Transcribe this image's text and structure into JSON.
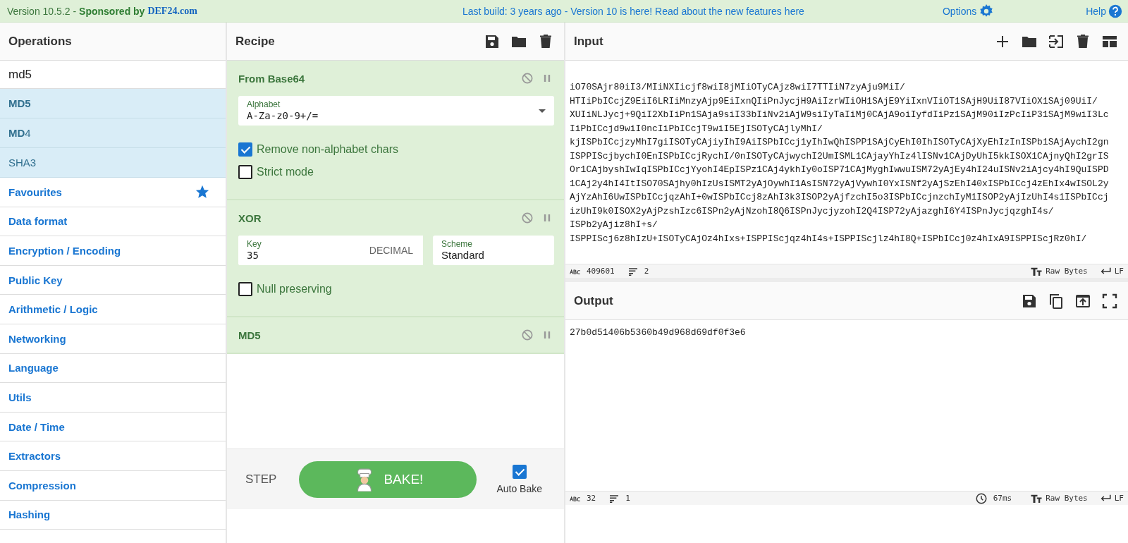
{
  "top_bar": {
    "version": "Version 10.5.2 -",
    "sponsor": "Sponsored by",
    "sponsor_link": "DEF24.com",
    "notice": "Last build: 3 years ago - Version 10 is here! Read about the new features",
    "notice_link": "here",
    "options": "Options",
    "help": "Help"
  },
  "operations": {
    "title": "Operations",
    "search": "md5",
    "results": [
      {
        "label": "**MD5**",
        "selected": false
      },
      {
        "label": "**MD**4",
        "selected": false
      },
      {
        "label": "SHA3",
        "selected": false
      }
    ],
    "categories": [
      {
        "label": "Favourites",
        "kind": "favourites"
      },
      {
        "label": "Data format",
        "kind": "category"
      },
      {
        "label": "Encryption / Encoding",
        "kind": "category"
      },
      {
        "label": "Public Key",
        "kind": "category"
      },
      {
        "label": "Arithmetic / Logic",
        "kind": "category"
      },
      {
        "label": "Networking",
        "kind": "category"
      },
      {
        "label": "Language",
        "kind": "category"
      },
      {
        "label": "Utils",
        "kind": "category"
      },
      {
        "label": "Date / Time",
        "kind": "category"
      },
      {
        "label": "Extractors",
        "kind": "category"
      },
      {
        "label": "Compression",
        "kind": "category"
      },
      {
        "label": "Hashing",
        "kind": "category"
      }
    ]
  },
  "recipe": {
    "title": "Recipe",
    "steps": [
      {
        "name": "From Base64",
        "args": [
          {
            "kind": "dropdown",
            "label": "Alphabet",
            "value": "A-Za-z0-9+/="
          },
          {
            "kind": "checkbox",
            "label": "Remove non-alphabet chars",
            "checked": true
          },
          {
            "kind": "checkbox",
            "label": "Strict mode",
            "checked": false
          }
        ]
      },
      {
        "name": "XOR",
        "args": [
          {
            "kind": "keyed",
            "label": "Key",
            "value": "35",
            "option": "DECIMAL"
          },
          {
            "kind": "text",
            "label": "Scheme",
            "value": "Standard"
          },
          {
            "kind": "checkbox",
            "label": "Null preserving",
            "checked": false
          }
        ]
      },
      {
        "name": "MD5"
      }
    ],
    "step": "STEP",
    "bake": "BAKE!",
    "auto_bake": "Auto Bake",
    "auto_bake_checked": true
  },
  "input": {
    "title": "Input",
    "lines": [
      "iO70SAjr80iI3/MIiNXIicjf8wiI8jMIiOTyCAjz8wiI7TTIiN7zyAju9MiI/",
      "HTIiPbICcjZ9EiI6LRIiMnzyAjp9EiIxnQIiPnJycjH9AiIzrWIiOH1SAjE9YiIxnVIiOT1SAjH9UiI87VIiOX1SAj09UiI/",
      "XUIiNLJycj+9QiI2XbIiPn1SAja9siI33bIiNv2iAjW9siIyTaIiMj0CAjA9oiIyfdIiPz1SAjM90iIzPcIiP31SAjM9wiI3Lc",
      "IiPbICcjd9wiI0ncIiPbICcjT9wiI5EjISOTyCAjlyMhI/",
      "kjISPbICcjzyMhI7giISOTyCAjiyIhI9AiISPbICcj1yIhIwQhISPP1SAjCyEhI0IhISOTyCAjXyEhIzInISPb1SAjAychI2gn",
      "ISPPIScjbychI0EnISPbICcjRychI/0nISOTyCAjwychI2UmISML1CAjayYhIz4lISNv1CAjDyUhI5kkISOX1CAjnyQhI2grIS",
      "Or1CAjbyshIwIqISPbICcjYyohI4EpISPz1CAj4ykhIy0oISP71CAjMyghIwwuISM72yAjEy4hI24uISNv2iAjcy4hI9QuISPD",
      "1CAj2y4hI4ItISO70SAjhy0hIzUsISMT2yAjOywhI1AsISN72yAjVywhI0YxISNf2yAjSzEhI40xISPbICcj4zEhIx4wISOL2y",
      "AjYzAhI6UwISPbICcjqzAhI+0wISPbICcj8zAhI3k3ISOP2yAjfzchI5o3ISPbICcjnzchIyM1ISOP2yAjIzUhI4s1ISPbICcj",
      "izUhI9k0ISOX2yAjPzshIzc6ISPn2yAjNzohI8Q6ISPnJycjyzohI2Q4ISP72yAjazghI6Y4ISPnJycjqzghI4s/",
      "ISPb2yAjiz8hI+s/",
      "ISPPIScj6z8hIzU+ISOTyCAjOz4hIxs+ISPPIScjqz4hI4s+ISPPIScjlz4hI8Q+ISPbICcj0z4hIxA9ISPPIScjRz0hI/"
    ],
    "length": "409601",
    "line_count": "2",
    "encoding": "Raw Bytes",
    "eol": "LF"
  },
  "output": {
    "title": "Output",
    "text": "27b0d51406b5360b49d968d69df0f3e6",
    "length": "32",
    "line_count": "1",
    "time": "67ms",
    "encoding": "Raw Bytes",
    "eol": "LF"
  }
}
